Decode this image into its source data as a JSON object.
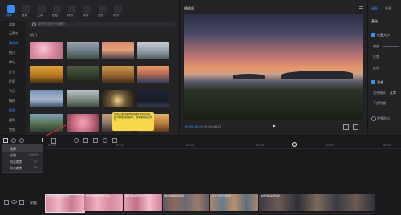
{
  "toolbar": {
    "tabs": [
      "媒体",
      "音频",
      "文本",
      "贴纸",
      "特效",
      "转场",
      "滤镜",
      "调节"
    ]
  },
  "sidebar": {
    "items": [
      "本地",
      "云素材",
      "素材库",
      "热门",
      "转场",
      "片头",
      "片尾",
      "节日",
      "情绪",
      "氛围",
      "故障",
      "空镜",
      "绿幕",
      "搞笑片段",
      "收藏"
    ]
  },
  "media": {
    "search_placeholder": "搜索在线素材/关键词",
    "section_label": "热门"
  },
  "tooltip": {
    "text": "按住从素材库中拖动素材到时间线，即可添加到视频中。选中素材后可预览"
  },
  "player": {
    "title": "播放器",
    "time_current": "00:00:08:00",
    "time_total": "00:00:46:20"
  },
  "right_panel": {
    "tabs": [
      "画面",
      "变速",
      "动画",
      "调节"
    ],
    "labels": [
      "基础",
      "位置大小",
      "缩放",
      "位置",
      "旋转",
      "混合",
      "混合模式",
      "不透明度",
      "视频防抖"
    ],
    "values": [
      "100%",
      "0°",
      "正常",
      "100%"
    ]
  },
  "context_menu": {
    "items": [
      "选择",
      "分割",
      "向左裁剪",
      "向右裁剪"
    ],
    "shortcuts": [
      "",
      "Ctrl+B",
      "Q",
      "W"
    ]
  },
  "timeline": {
    "ticks": [
      "00:00",
      "00:10",
      "00:20",
      "00:30",
      "00:40",
      "00:50"
    ],
    "track_label": "封面",
    "clip_labels": [
      "樱花素材视频春天花朵",
      "樱花素材视频春天花朵",
      "樱花素材视频春天花朵",
      "城市地面航拍延时",
      "海上日出日落风景",
      "城市道路车流延时"
    ]
  },
  "colors": {
    "accent": "#3a8df5",
    "playhead": "#ffffff",
    "tooltip_bg": "#f5d94a"
  }
}
